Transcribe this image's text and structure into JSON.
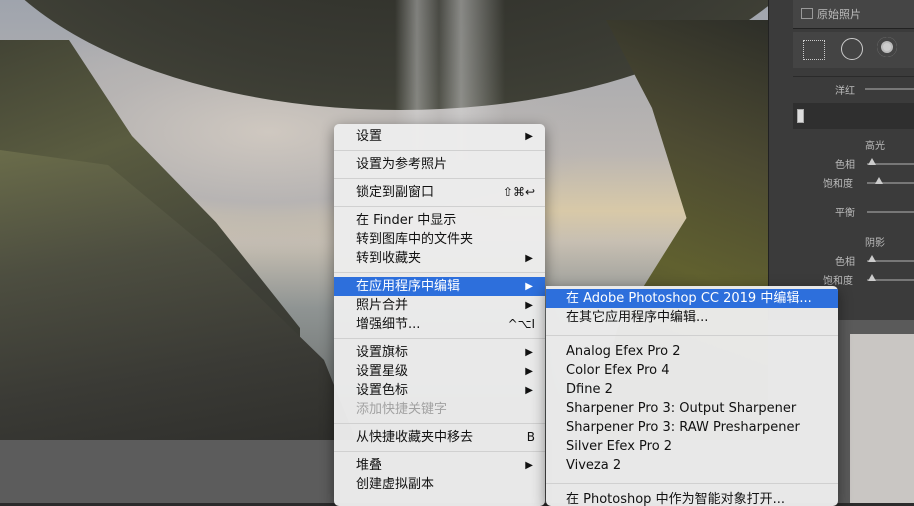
{
  "right_panel": {
    "original_photo_label": "原始照片",
    "magenta_label": "洋红",
    "highlights_label": "高光",
    "hue_label": "色相",
    "saturation_label": "饱和度",
    "balance_label": "平衡",
    "shadows_label": "阴影",
    "hue2_label": "色相",
    "saturation2_label": "饱和度"
  },
  "context_menu": {
    "items": [
      {
        "label": "设置",
        "submenu": true
      },
      {
        "label": "设置为参考照片"
      },
      {
        "label": "锁定到副窗口",
        "shortcut": "⇧⌘↩"
      },
      {
        "label": "在 Finder 中显示"
      },
      {
        "label": "转到图库中的文件夹"
      },
      {
        "label": "转到收藏夹",
        "submenu": true
      },
      {
        "label": "在应用程序中编辑",
        "submenu": true,
        "highlighted": true
      },
      {
        "label": "照片合并",
        "submenu": true
      },
      {
        "label": "增强细节...",
        "shortcut": "^⌥I"
      },
      {
        "label": "设置旗标",
        "submenu": true
      },
      {
        "label": "设置星级",
        "submenu": true
      },
      {
        "label": "设置色标",
        "submenu": true
      },
      {
        "label": "添加快捷关键字",
        "disabled": true
      },
      {
        "label": "从快捷收藏夹中移去",
        "shortcut": "B"
      },
      {
        "label": "堆叠",
        "submenu": true
      },
      {
        "label": "创建虚拟副本"
      }
    ],
    "arrow_glyph": "▶"
  },
  "edit_in_submenu": {
    "items": [
      {
        "label": "在 Adobe Photoshop CC 2019 中编辑...",
        "highlighted": true
      },
      {
        "label": "在其它应用程序中编辑..."
      },
      {
        "label": "Analog Efex Pro 2"
      },
      {
        "label": "Color Efex Pro 4"
      },
      {
        "label": "Dfine 2"
      },
      {
        "label": "Sharpener Pro 3: Output Sharpener"
      },
      {
        "label": "Sharpener Pro 3: RAW Presharpener"
      },
      {
        "label": "Silver Efex Pro 2"
      },
      {
        "label": "Viveza 2"
      },
      {
        "label": "在 Photoshop 中作为智能对象打开..."
      }
    ]
  },
  "colors": {
    "menu_highlight": "#2d6fdc",
    "menu_background": "#ececec",
    "panel_background": "#3b3b3b"
  }
}
